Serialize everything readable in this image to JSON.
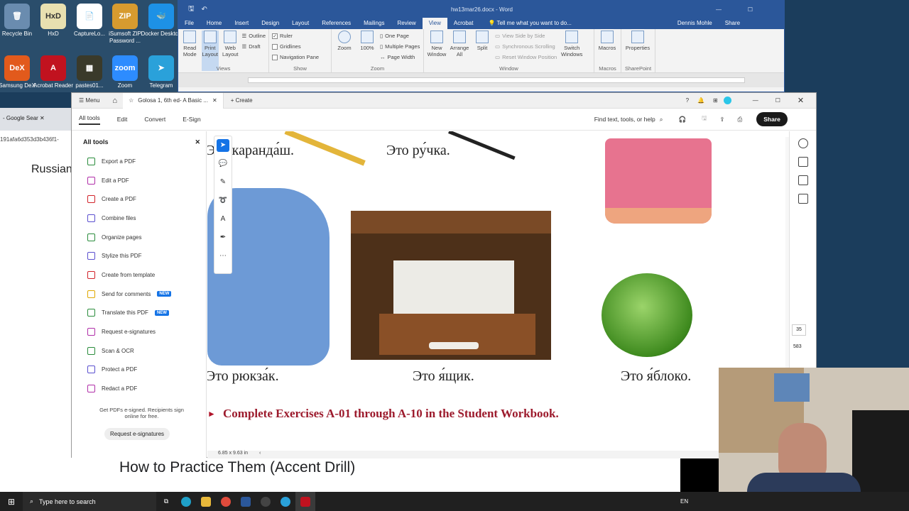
{
  "desktop": {
    "icons": [
      {
        "label": "Recycle Bin",
        "color": "#6a8caf",
        "glyph": "🗑"
      },
      {
        "label": "HxD",
        "color": "#e8e0b0",
        "glyph": "HxD"
      },
      {
        "label": "CaptureLo...",
        "color": "#ffffff",
        "glyph": "📄"
      },
      {
        "label": "iSumsoft ZIP Password ...",
        "color": "#d79b2f",
        "glyph": "ZIP"
      },
      {
        "label": "Docker Desktop",
        "color": "#1d91e6",
        "glyph": "🐳"
      },
      {
        "label": "Samsung DeX",
        "color": "#e25a1c",
        "glyph": "DeX"
      },
      {
        "label": "Acrobat Reader",
        "color": "#c1121f",
        "glyph": "A"
      },
      {
        "label": "pastes01...",
        "color": "#3a3a2a",
        "glyph": "▦"
      },
      {
        "label": "Zoom",
        "color": "#2d8cff",
        "glyph": "zoom"
      },
      {
        "label": "Telegram",
        "color": "#2aa1da",
        "glyph": "➤"
      }
    ]
  },
  "word": {
    "title": "hw13mar26.docx - Word",
    "tabs": [
      "File",
      "Home",
      "Insert",
      "Design",
      "Layout",
      "References",
      "Mailings",
      "Review",
      "View",
      "Acrobat"
    ],
    "active_tab": "View",
    "tell_me": "Tell me what you want to do...",
    "user": "Dennis Mohle",
    "share": "Share",
    "views": {
      "label": "Views",
      "read": "Read Mode",
      "print": "Print Layout",
      "web": "Web Layout",
      "outline": "Outline",
      "draft": "Draft"
    },
    "show": {
      "label": "Show",
      "ruler": "Ruler",
      "gridlines": "Gridlines",
      "nav": "Navigation Pane"
    },
    "zoom": {
      "label": "Zoom",
      "zoom": "Zoom",
      "pct": "100%",
      "one": "One Page",
      "multi": "Multiple Pages",
      "width": "Page Width"
    },
    "window": {
      "label": "Window",
      "new": "New Window",
      "arrange": "Arrange All",
      "split": "Split",
      "side": "View Side by Side",
      "sync": "Synchronous Scrolling",
      "reset": "Reset Window Position",
      "switch": "Switch Windows"
    },
    "macros": {
      "label": "Macros",
      "btn": "Macros"
    },
    "sharepoint": {
      "label": "SharePoint",
      "btn": "Properties"
    }
  },
  "browser_behind": {
    "tab": "- Google Sear",
    "hash": "191afa6d353d3b436f1-",
    "heading": "Russian",
    "bottom_heading": "How to Practice Them (Accent Drill)"
  },
  "acrobat": {
    "menu": "Menu",
    "tab_title": "Golosa 1, 6th ed- A Basic ...",
    "create": "Create",
    "toolbar": [
      "All tools",
      "Edit",
      "Convert",
      "E-Sign"
    ],
    "find": "Find text, tools, or help",
    "share": "Share",
    "panel_title": "All tools",
    "tools": [
      {
        "label": "Export a PDF",
        "color": "#2a8c3c",
        "new": ""
      },
      {
        "label": "Edit a PDF",
        "color": "#b02ea8",
        "new": ""
      },
      {
        "label": "Create a PDF",
        "color": "#d2232a",
        "new": ""
      },
      {
        "label": "Combine files",
        "color": "#5a4fcf",
        "new": ""
      },
      {
        "label": "Organize pages",
        "color": "#2a8c3c",
        "new": ""
      },
      {
        "label": "Stylize this PDF",
        "color": "#5a4fcf",
        "new": ""
      },
      {
        "label": "Create from template",
        "color": "#d2232a",
        "new": ""
      },
      {
        "label": "Send for comments",
        "color": "#e0a800",
        "new": "NEW"
      },
      {
        "label": "Translate this PDF",
        "color": "#2a8c3c",
        "new": "NEW"
      },
      {
        "label": "Request e-signatures",
        "color": "#b02ea8",
        "new": ""
      },
      {
        "label": "Scan & OCR",
        "color": "#2a8c3c",
        "new": ""
      },
      {
        "label": "Protect a PDF",
        "color": "#5a4fcf",
        "new": ""
      },
      {
        "label": "Redact a PDF",
        "color": "#b02ea8",
        "new": ""
      }
    ],
    "esign_note": "Get PDFs e-signed. Recipients sign online for free.",
    "esign_button": "Request e-signatures",
    "page_size": "6.85 x 9.63 in",
    "page_num": "35",
    "page_total": "583",
    "doc": {
      "pencil": "Это каранда́ш.",
      "pen": "Это ру́чка.",
      "backpack": "Это рюкза́к.",
      "drawer": "Это я́щик.",
      "apple": "Это я́блоко.",
      "exercise": "Complete Exercises A-01 through A-10 in the Student Workbook."
    }
  },
  "taskbar": {
    "search": "Type here to search",
    "lang": "EN"
  }
}
